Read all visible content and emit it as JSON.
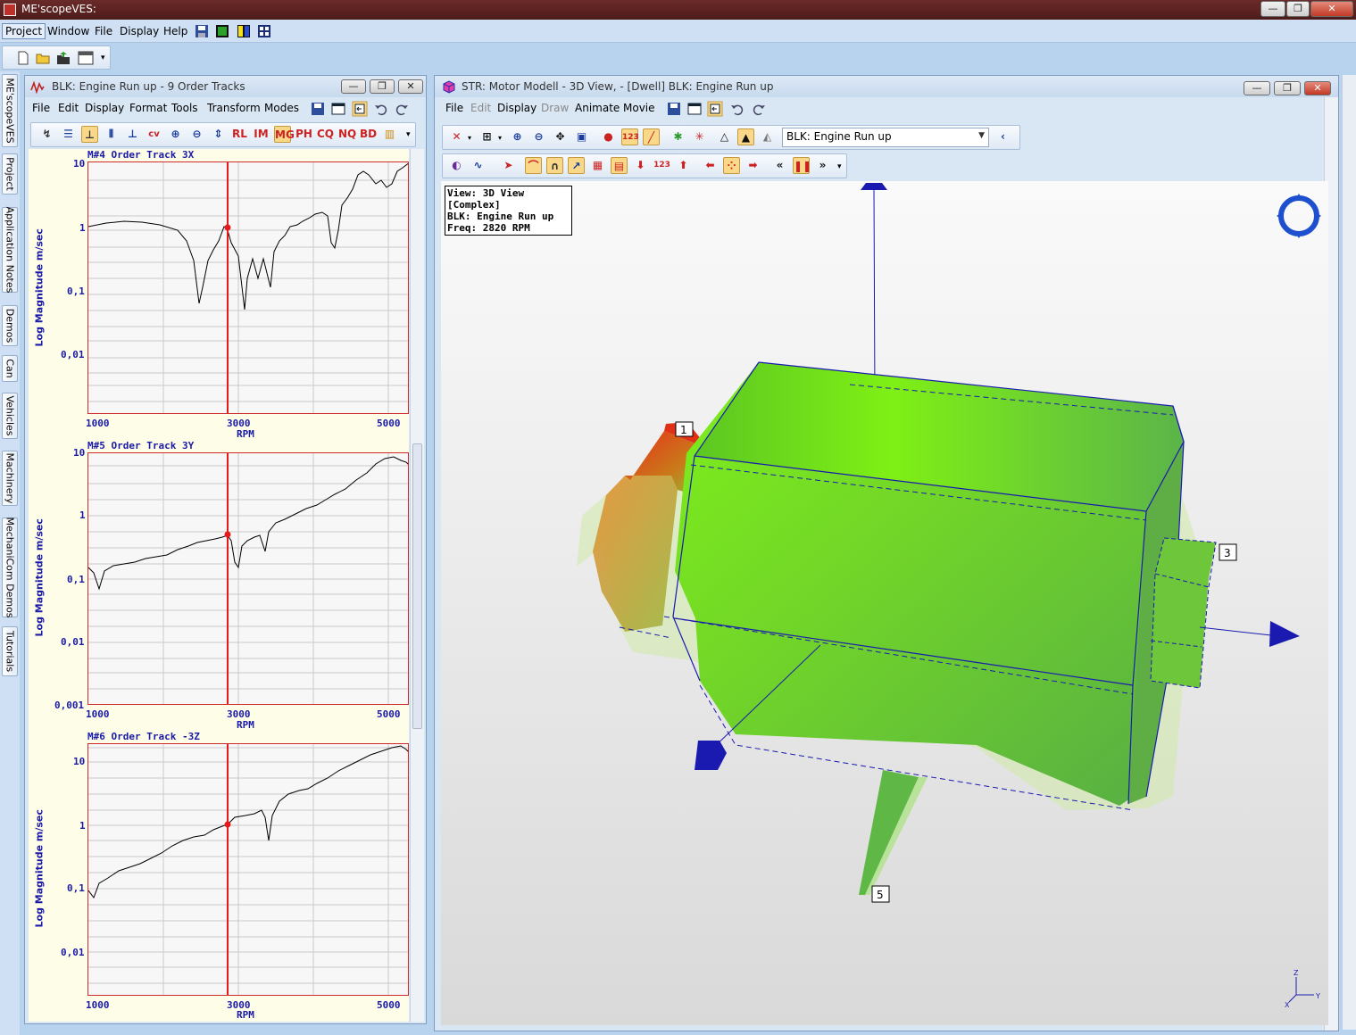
{
  "app": {
    "title": "ME'scopeVES:",
    "menu": [
      "Project",
      "Window",
      "File",
      "Display",
      "Help"
    ]
  },
  "sidetabs": [
    "ME'scopeVES",
    "Project",
    "Application Notes",
    "Demos",
    "Can",
    "Vehicles",
    "Machinery",
    "MechaniCom Demos",
    "Tutorials"
  ],
  "left_window": {
    "title": "BLK: Engine Run up - 9 Order Tracks",
    "menu": [
      "File",
      "Edit",
      "Display",
      "Format",
      "Tools",
      "Transform",
      "Modes"
    ],
    "toolbar": [
      "RL",
      "IM",
      "MG",
      "PH",
      "CQ",
      "NQ",
      "BD"
    ],
    "plots": [
      {
        "title": "M#4 Order Track 3X",
        "ylabel": "Log Magnitude m/sec",
        "xlabel": "RPM",
        "yticks": [
          "10",
          "1",
          "0,1",
          "0,01"
        ],
        "xticks": [
          "1000",
          "3000",
          "5000"
        ]
      },
      {
        "title": "M#5 Order Track 3Y",
        "ylabel": "Log Magnitude m/sec",
        "xlabel": "RPM",
        "yticks": [
          "10",
          "1",
          "0,1",
          "0,01",
          "0,001"
        ],
        "xticks": [
          "1000",
          "3000",
          "5000"
        ]
      },
      {
        "title": "M#6 Order Track -3Z",
        "ylabel": "Log Magnitude m/sec",
        "xlabel": "RPM",
        "yticks": [
          "10",
          "1",
          "0,1",
          "0,01"
        ],
        "xticks": [
          "1000",
          "3000",
          "5000"
        ]
      }
    ]
  },
  "right_window": {
    "title": "STR: Motor Modell - 3D View,  - [Dwell] BLK: Engine Run up",
    "menu": [
      "File",
      "Edit",
      "Display",
      "Draw",
      "Animate",
      "Movie"
    ],
    "menu_disabled": [
      "Edit",
      "Draw"
    ],
    "combo_value": "BLK: Engine Run up",
    "info": [
      "View: 3D View [Complex]",
      "BLK: Engine Run up",
      "Freq: 2820 RPM"
    ],
    "point_labels": [
      "1",
      "3",
      "5"
    ],
    "axis_labels": [
      "Z",
      "Y",
      "X"
    ]
  },
  "colors": {
    "accent_red": "#d12a2a",
    "axis_blue": "#1a1aa8",
    "model_green": "#7ee21a"
  }
}
